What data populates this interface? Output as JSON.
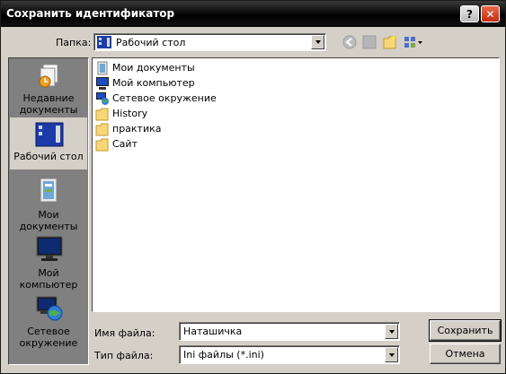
{
  "window": {
    "title": "Сохранить идентификатор",
    "help_label": "?",
    "close_label": "✕"
  },
  "lookin": {
    "label": "Папка:",
    "value": "Рабочий стол"
  },
  "toolbar": {
    "items": [
      "back-icon",
      "up-folder-icon",
      "new-folder-icon",
      "view-menu-icon"
    ]
  },
  "places": [
    {
      "label_line1": "Недавние",
      "label_line2": "документы",
      "icon": "recent-documents-icon"
    },
    {
      "label_line1": "Рабочий стол",
      "label_line2": "",
      "icon": "desktop-icon"
    },
    {
      "label_line1": "Мои документы",
      "label_line2": "",
      "icon": "my-documents-icon"
    },
    {
      "label_line1": "Мой компьютер",
      "label_line2": "",
      "icon": "my-computer-icon"
    },
    {
      "label_line1": "Сетевое",
      "label_line2": "окружение",
      "icon": "network-icon"
    }
  ],
  "files": [
    {
      "name": "Мои документы",
      "icon": "my-documents-icon"
    },
    {
      "name": "Мой компьютер",
      "icon": "my-computer-icon"
    },
    {
      "name": "Сетевое окружение",
      "icon": "network-icon"
    },
    {
      "name": "History",
      "icon": "folder-icon"
    },
    {
      "name": "практика",
      "icon": "folder-icon"
    },
    {
      "name": "Сайт",
      "icon": "folder-icon"
    }
  ],
  "filename": {
    "label": "Имя файла:",
    "value": "Наташичка"
  },
  "filetype": {
    "label": "Тип файла:",
    "value": "Ini файлы (*.ini)"
  },
  "buttons": {
    "save": "Сохранить",
    "cancel": "Отмена"
  }
}
